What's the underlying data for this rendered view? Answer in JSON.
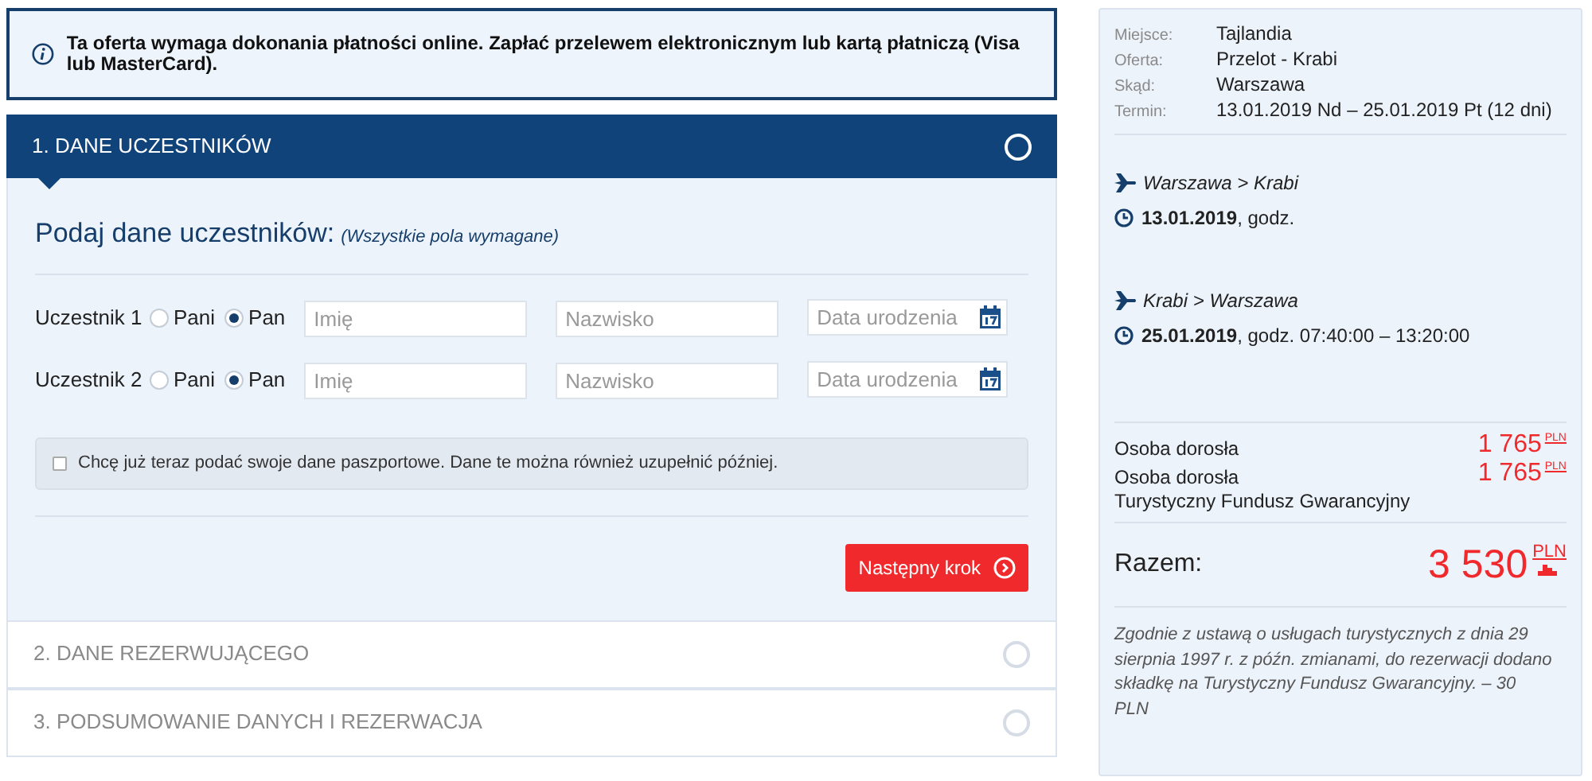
{
  "notice": {
    "text": "Ta oferta wymaga dokonania płatności online. Zapłać przelewem elektronicznym lub kartą płatniczą (Visa lub MasterCard)."
  },
  "steps": [
    {
      "title": "1. DANE UCZESTNIKÓW",
      "expanded": true
    },
    {
      "title": "2. DANE REZERWUJĄCEGO",
      "expanded": false
    },
    {
      "title": "3. PODSUMOWANIE DANYCH I REZERWACJA",
      "expanded": false
    }
  ],
  "form": {
    "heading": "Podaj dane uczestników:",
    "hint": "(Wszystkie pola wymagane)",
    "participants": [
      {
        "label": "Uczestnik 1",
        "options": [
          {
            "label": "Pani",
            "selected": false
          },
          {
            "label": "Pan",
            "selected": true
          }
        ],
        "first_name": {
          "placeholder": "Imię"
        },
        "last_name": {
          "placeholder": "Nazwisko"
        },
        "birth_date": {
          "placeholder": "Data urodzenia"
        }
      },
      {
        "label": "Uczestnik 2",
        "options": [
          {
            "label": "Pani",
            "selected": false
          },
          {
            "label": "Pan",
            "selected": true
          }
        ],
        "first_name": {
          "placeholder": "Imię"
        },
        "last_name": {
          "placeholder": "Nazwisko"
        },
        "birth_date": {
          "placeholder": "Data urodzenia"
        }
      }
    ],
    "passport": {
      "label": "Chcę już teraz podać swoje dane paszportowe. Dane te można również uzupełnić później.",
      "checked": false
    },
    "next_button": "Następny krok"
  },
  "summary": {
    "details": [
      {
        "label": "Miejsce:",
        "value": "Tajlandia"
      },
      {
        "label": "Oferta:",
        "value": "Przelot - Krabi"
      },
      {
        "label": "Skąd:",
        "value": "Warszawa"
      },
      {
        "label": "Termin:",
        "value": "13.01.2019 Nd – 25.01.2019 Pt (12 dni)"
      }
    ],
    "flights": [
      {
        "route": "Warszawa > Krabi",
        "time": "**13.01.2019**, godz."
      },
      {
        "route": "Krabi > Warszawa",
        "time": "**25.01.2019**, godz. 07:40:00 – 13:20:00"
      }
    ],
    "prices": [
      {
        "label": "Osoba dorosła",
        "amount": "1 765",
        "currency": "PLN"
      },
      {
        "label": "Osoba dorosła",
        "amount": "1 765",
        "currency": "PLN"
      }
    ],
    "fund_label": "Turystyczny Fundusz Gwarancyjny",
    "total": {
      "label": "Razem:",
      "amount": "3 530",
      "currency": "PLN"
    },
    "note": "Zgodnie z ustawą o usługach turystycznych z dnia 29 sierpnia 1997 r. z późn. zmianami, do rezerwacji dodano składkę na Turystyczny Fundusz Gwarancyjny. – 30 PLN"
  }
}
